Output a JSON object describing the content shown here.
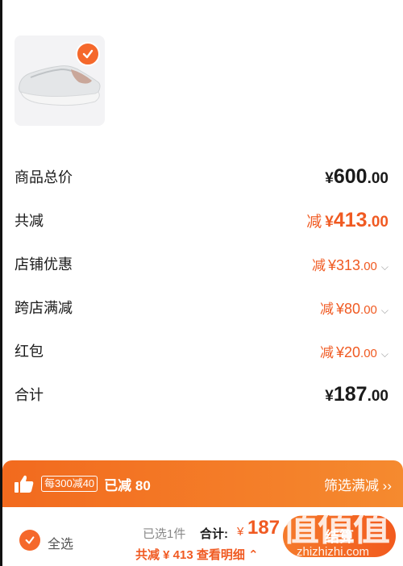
{
  "product": {
    "image_icon": "sneaker-image",
    "selected": true
  },
  "summary": {
    "total_price": {
      "label": "商品总价",
      "yen": "¥",
      "int": "600",
      "dec": ".00"
    },
    "total_discount": {
      "label": "共减",
      "prefix": "减",
      "yen": "¥",
      "int": "413",
      "dec": ".00"
    },
    "store_discount": {
      "label": "店铺优惠",
      "prefix": "减",
      "yen": "¥",
      "int": "313",
      "dec": ".00"
    },
    "cross_store": {
      "label": "跨店满减",
      "prefix": "减",
      "yen": "¥",
      "int": "80",
      "dec": ".00"
    },
    "red_packet": {
      "label": "红包",
      "prefix": "减",
      "yen": "¥",
      "int": "20",
      "dec": ".00"
    },
    "subtotal": {
      "label": "合计",
      "yen": "¥",
      "int": "187",
      "dec": ".00"
    }
  },
  "promo": {
    "tag": "每300减40",
    "text": "已减 80",
    "action": "筛选满减 ››"
  },
  "bottom": {
    "select_all": "全选",
    "selected_count": "已选1件",
    "total_label": "合计:",
    "total_yen": "¥",
    "total_value": "187",
    "discount_line": "共减 ¥ 413  查看明细 ⌃",
    "checkout": "结算"
  },
  "watermark": {
    "glyphs": "值值值",
    "url": "zhizhizhi.com"
  },
  "colors": {
    "accent": "#f05a22",
    "promo_bar": "#f26a1e"
  }
}
